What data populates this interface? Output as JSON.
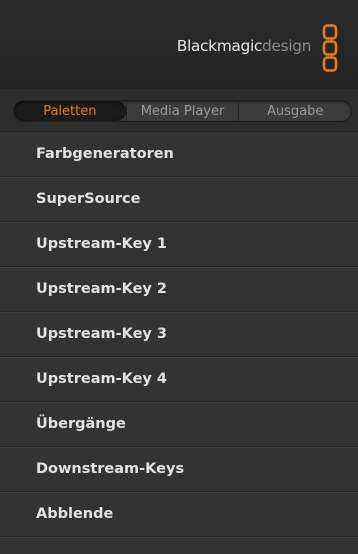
{
  "header": {
    "brand_bold": "Blackmagic",
    "brand_light": "design",
    "logo_icon": "blackmagic-logo-icon",
    "accent_color": "#f07a1e"
  },
  "tabs": [
    {
      "label": "Paletten",
      "active": true
    },
    {
      "label": "Media Player",
      "active": false
    },
    {
      "label": "Ausgabe",
      "active": false
    }
  ],
  "palettes": [
    {
      "label": "Farbgeneratoren"
    },
    {
      "label": "SuperSource"
    },
    {
      "label": "Upstream-Key 1"
    },
    {
      "label": "Upstream-Key 2"
    },
    {
      "label": "Upstream-Key 3"
    },
    {
      "label": "Upstream-Key 4"
    },
    {
      "label": "Übergänge"
    },
    {
      "label": "Downstream-Keys"
    },
    {
      "label": "Abblende"
    }
  ]
}
